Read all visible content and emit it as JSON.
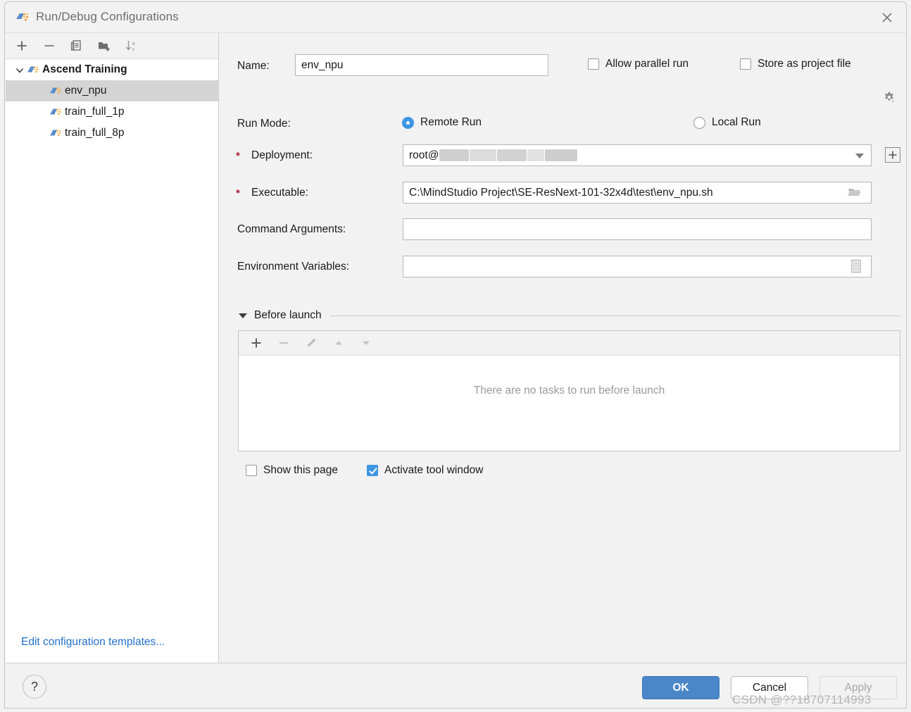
{
  "window": {
    "title": "Run/Debug Configurations",
    "icon": "ascend-config-icon",
    "close_label": "×"
  },
  "sidebar": {
    "toolbar": [
      {
        "name": "add-configuration-button",
        "icon": "plus-icon",
        "label": "+"
      },
      {
        "name": "remove-configuration-button",
        "icon": "minus-icon",
        "label": "−"
      },
      {
        "name": "copy-configuration-button",
        "icon": "copy-icon",
        "label": "Copy"
      },
      {
        "name": "new-folder-button",
        "icon": "folder-add-icon",
        "label": "New Folder"
      },
      {
        "name": "sort-configurations-button",
        "icon": "sort-az-icon",
        "label": "Sort"
      }
    ],
    "tree": {
      "group": {
        "label": "Ascend Training",
        "expanded": true
      },
      "items": [
        {
          "label": "env_npu",
          "selected": true
        },
        {
          "label": "train_full_1p",
          "selected": false
        },
        {
          "label": "train_full_8p",
          "selected": false
        }
      ]
    },
    "edit_templates_link": "Edit configuration templates..."
  },
  "form": {
    "name_label": "Name:",
    "name_value": "env_npu",
    "name_placeholder": "",
    "allow_parallel_run": {
      "label": "Allow parallel run",
      "checked": false
    },
    "store_as_project_file": {
      "label": "Store as project file",
      "checked": false,
      "icon": "gear-dropdown-icon"
    },
    "run_mode_label": "Run Mode:",
    "run_mode_options": [
      {
        "label": "Remote Run",
        "selected": true
      },
      {
        "label": "Local Run",
        "selected": false
      }
    ],
    "deployment_label": "Deployment:",
    "deployment_required": "*",
    "deployment_value": "root@",
    "deployment_redacted": true,
    "deployment_add_button": "+",
    "executable_label": "Executable:",
    "executable_required": "*",
    "executable_value": "C:\\MindStudio Project\\SE-ResNext-101-32x4d\\test\\env_npu.sh",
    "executable_browse_icon": "folder-browse-icon",
    "command_arguments_label": "Command Arguments:",
    "command_arguments_value": "",
    "environment_variables_label": "Environment Variables:",
    "environment_variables_value": "",
    "environment_variables_icon": "list-editor-icon"
  },
  "before_launch": {
    "title": "Before launch",
    "expanded": true,
    "toolbar": [
      {
        "name": "add-task-button",
        "icon": "plus-icon",
        "enabled": true
      },
      {
        "name": "remove-task-button",
        "icon": "minus-icon",
        "enabled": false
      },
      {
        "name": "edit-task-button",
        "icon": "pencil-icon",
        "enabled": false
      },
      {
        "name": "move-task-up-button",
        "icon": "arrow-up-icon",
        "enabled": false
      },
      {
        "name": "move-task-down-button",
        "icon": "arrow-down-icon",
        "enabled": false
      }
    ],
    "empty_text": "There are no tasks to run before launch",
    "show_this_page": {
      "label": "Show this page",
      "checked": false
    },
    "activate_tool_window": {
      "label": "Activate tool window",
      "checked": true
    }
  },
  "footer": {
    "help_label": "?",
    "ok_label": "OK",
    "cancel_label": "Cancel",
    "apply_label": "Apply",
    "apply_enabled": false
  },
  "watermark": "CSDN @??18707114993",
  "colors": {
    "accent": "#4a86c8",
    "checkbox_checked": "#3d96e3",
    "link": "#2470c9",
    "required_star": "#a8203a",
    "selection": "#d4d4d4"
  }
}
